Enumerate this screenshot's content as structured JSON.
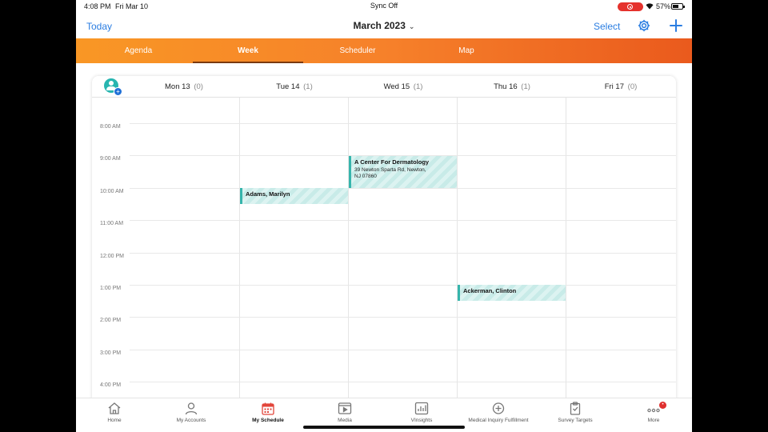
{
  "status": {
    "time": "4:08 PM",
    "date": "Fri Mar 10",
    "sync": "Sync Off",
    "battery": "57%"
  },
  "nav": {
    "today": "Today",
    "month": "March 2023",
    "select": "Select"
  },
  "tabs": [
    "Agenda",
    "Week",
    "Scheduler",
    "Map"
  ],
  "active_tab": "Week",
  "days": [
    {
      "label": "Mon 13",
      "count": "(0)"
    },
    {
      "label": "Tue 14",
      "count": "(1)"
    },
    {
      "label": "Wed 15",
      "count": "(1)"
    },
    {
      "label": "Thu 16",
      "count": "(1)"
    },
    {
      "label": "Fri 17",
      "count": "(0)"
    }
  ],
  "hours": [
    "8:00 AM",
    "9:00 AM",
    "10:00 AM",
    "11:00 AM",
    "12:00 PM",
    "1:00 PM",
    "2:00 PM",
    "3:00 PM",
    "4:00 PM"
  ],
  "events": {
    "wed": {
      "title": "A Center For Dermatology",
      "address1": "39 Newton Sparta Rd, Newton,",
      "address2": "NJ 07860"
    },
    "tue": {
      "title": "Adams, Marilyn"
    },
    "thu": {
      "title": "Ackerman, Clinton"
    }
  },
  "bottom": [
    "Home",
    "My Accounts",
    "My Schedule",
    "Media",
    "VInsights",
    "Medical Inquiry Fulfillment",
    "Survey Targets",
    "More"
  ],
  "bottom_active": "My Schedule",
  "colors": {
    "accent": "#2a7de1",
    "event": "#36b5ac",
    "tab_start": "#f99725",
    "tab_end": "#ea5a1d"
  }
}
